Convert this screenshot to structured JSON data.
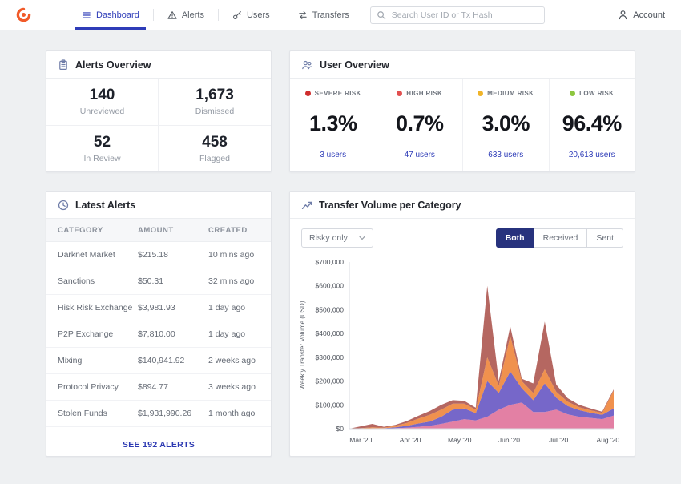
{
  "navbar": {
    "items": [
      {
        "label": "Dashboard",
        "active": true
      },
      {
        "label": "Alerts",
        "active": false
      },
      {
        "label": "Users",
        "active": false
      },
      {
        "label": "Transfers",
        "active": false
      }
    ],
    "search_placeholder": "Search User ID or Tx Hash",
    "account_label": "Account"
  },
  "colors": {
    "accent_blue": "#2e3cb8",
    "brand_orange": "#f15a29",
    "toggle_active_bg": "#27327d"
  },
  "alerts_overview": {
    "title": "Alerts Overview",
    "stats": [
      {
        "value": "140",
        "label": "Unreviewed"
      },
      {
        "value": "1,673",
        "label": "Dismissed"
      },
      {
        "value": "52",
        "label": "In Review"
      },
      {
        "value": "458",
        "label": "Flagged"
      }
    ]
  },
  "user_overview": {
    "title": "User Overview",
    "segments": [
      {
        "label": "SEVERE RISK",
        "percent": "1.3%",
        "users": "3 users",
        "color": "#cf2d2d"
      },
      {
        "label": "HIGH RISK",
        "percent": "0.7%",
        "users": "47 users",
        "color": "#e25050"
      },
      {
        "label": "MEDIUM RISK",
        "percent": "3.0%",
        "users": "633 users",
        "color": "#f0b429"
      },
      {
        "label": "LOW RISK",
        "percent": "96.4%",
        "users": "20,613 users",
        "color": "#8dc63f"
      }
    ]
  },
  "latest_alerts": {
    "title": "Latest Alerts",
    "columns": [
      "CATEGORY",
      "AMOUNT",
      "CREATED"
    ],
    "rows": [
      [
        "Darknet Market",
        "$215.18",
        "10 mins ago"
      ],
      [
        "Sanctions",
        "$50.31",
        "32 mins ago"
      ],
      [
        "Hisk Risk Exchange",
        "$3,981.93",
        "1 day ago"
      ],
      [
        "P2P Exchange",
        "$7,810.00",
        "1 day ago"
      ],
      [
        "Mixing",
        "$140,941.92",
        "2 weeks ago"
      ],
      [
        "Protocol Privacy",
        "$894.77",
        "3 weeks ago"
      ],
      [
        "Stolen Funds",
        "$1,931,990.26",
        "1 month ago"
      ]
    ],
    "footer_link": "SEE 192 ALERTS"
  },
  "transfer_volume": {
    "title": "Transfer Volume per Category",
    "filter_label": "Risky only",
    "toggle": [
      {
        "label": "Both",
        "active": true
      },
      {
        "label": "Received",
        "active": false
      },
      {
        "label": "Sent",
        "active": false
      }
    ]
  },
  "chart_data": {
    "type": "area",
    "stacked": true,
    "title": "Transfer Volume per Category",
    "xlabel": "",
    "ylabel": "Weekly Transfer Volume (USD)",
    "ymax": 700000,
    "grid": false,
    "legend": "none",
    "yticks": [
      {
        "value": 0,
        "label": "$0"
      },
      {
        "value": 100000,
        "label": "$100,000"
      },
      {
        "value": 200000,
        "label": "$200,000"
      },
      {
        "value": 300000,
        "label": "$300,000"
      },
      {
        "value": 400000,
        "label": "$400,000"
      },
      {
        "value": 500000,
        "label": "$500,000"
      },
      {
        "value": 600000,
        "label": "$600,000"
      },
      {
        "value": 700000,
        "label": "$700,000"
      }
    ],
    "x_unit": "week-index",
    "xticks": [
      {
        "pos": 1,
        "label": "Mar '20"
      },
      {
        "pos": 5.3,
        "label": "Apr '20"
      },
      {
        "pos": 9.6,
        "label": "May '20"
      },
      {
        "pos": 13.9,
        "label": "Jun '20"
      },
      {
        "pos": 18.2,
        "label": "Jul '20"
      },
      {
        "pos": 22.5,
        "label": "Aug '20"
      }
    ],
    "series": [
      {
        "name": "category-1",
        "color": "#e2799f",
        "values": [
          0,
          0,
          0,
          0,
          2000,
          4000,
          8000,
          12000,
          20000,
          30000,
          40000,
          35000,
          50000,
          80000,
          100000,
          110000,
          70000,
          70000,
          80000,
          60000,
          50000,
          45000,
          40000,
          55000
        ]
      },
      {
        "name": "category-2",
        "color": "#6f5fc6",
        "values": [
          0,
          0,
          2000,
          2000,
          4000,
          8000,
          14000,
          18000,
          30000,
          50000,
          45000,
          30000,
          150000,
          70000,
          140000,
          60000,
          50000,
          120000,
          50000,
          35000,
          28000,
          22000,
          18000,
          30000
        ]
      },
      {
        "name": "category-3",
        "color": "#ef8b45",
        "values": [
          0,
          2000,
          4000,
          2000,
          6000,
          12000,
          20000,
          28000,
          30000,
          25000,
          20000,
          15000,
          100000,
          30000,
          150000,
          30000,
          30000,
          60000,
          25000,
          18000,
          12000,
          10000,
          8000,
          75000
        ]
      },
      {
        "name": "category-4",
        "color": "#b15f58",
        "values": [
          0,
          8000,
          14000,
          4000,
          4000,
          8000,
          12000,
          16000,
          20000,
          15000,
          12000,
          8000,
          300000,
          20000,
          40000,
          10000,
          40000,
          200000,
          30000,
          15000,
          10000,
          8000,
          5000,
          5000
        ]
      }
    ]
  }
}
